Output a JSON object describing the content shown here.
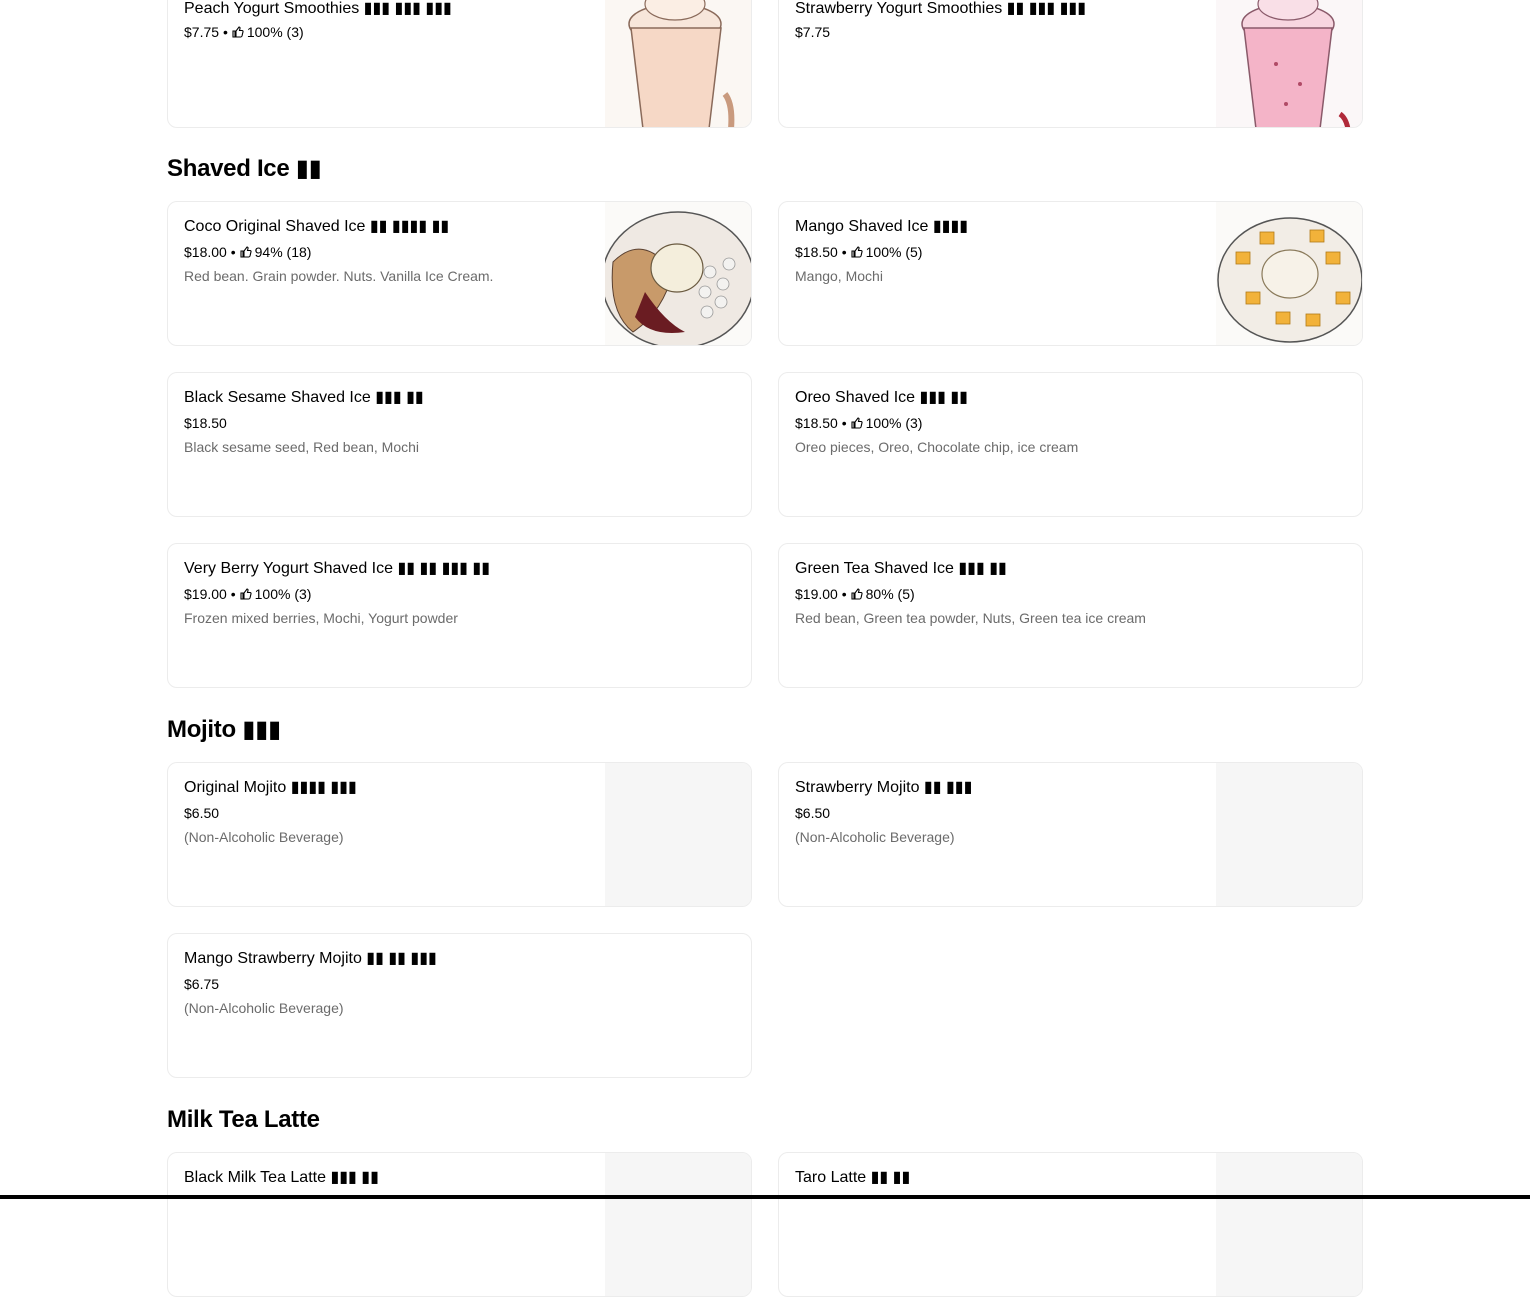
{
  "sections": [
    {
      "title": "",
      "items": [
        {
          "name": "Peach Yogurt Smoothies ▮▮▮ ▮▮▮ ▮▮▮",
          "price": "$7.75",
          "rating": "100% (3)",
          "desc": "",
          "thumb": "peach-smoothie"
        },
        {
          "name": "Strawberry Yogurt Smoothies ▮▮ ▮▮▮ ▮▮▮",
          "price": "$7.75",
          "rating": "",
          "desc": "",
          "thumb": "strawberry-smoothie"
        }
      ]
    },
    {
      "title": "Shaved Ice ▮▮",
      "items": [
        {
          "name": "Coco Original Shaved Ice ▮▮ ▮▮▮▮ ▮▮",
          "price": "$18.00",
          "rating": "94% (18)",
          "desc": "Red bean. Grain powder. Nuts. Vanilla Ice Cream.",
          "thumb": "coco-shaved-ice"
        },
        {
          "name": "Mango Shaved Ice ▮▮▮▮",
          "price": "$18.50",
          "rating": "100% (5)",
          "desc": "Mango, Mochi",
          "thumb": "mango-shaved-ice"
        },
        {
          "name": "Black Sesame Shaved Ice ▮▮▮ ▮▮",
          "price": "$18.50",
          "rating": "",
          "desc": "Black sesame seed, Red bean, Mochi",
          "thumb": ""
        },
        {
          "name": "Oreo Shaved Ice ▮▮▮ ▮▮",
          "price": "$18.50",
          "rating": "100% (3)",
          "desc": "Oreo pieces, Oreo, Chocolate chip, ice cream",
          "thumb": ""
        },
        {
          "name": "Very Berry Yogurt Shaved Ice ▮▮ ▮▮ ▮▮▮ ▮▮",
          "price": "$19.00",
          "rating": "100% (3)",
          "desc": "Frozen mixed berries, Mochi, Yogurt powder",
          "thumb": ""
        },
        {
          "name": "Green Tea Shaved Ice ▮▮▮ ▮▮",
          "price": "$19.00",
          "rating": "80% (5)",
          "desc": "Red bean, Green tea powder, Nuts, Green tea ice cream",
          "thumb": ""
        }
      ]
    },
    {
      "title": "Mojito ▮▮▮",
      "items": [
        {
          "name": "Original Mojito ▮▮▮▮ ▮▮▮",
          "price": "$6.50",
          "rating": "",
          "desc": "(Non-Alcoholic Beverage)",
          "thumb": "placeholder"
        },
        {
          "name": "Strawberry Mojito ▮▮ ▮▮▮",
          "price": "$6.50",
          "rating": "",
          "desc": "(Non-Alcoholic Beverage)",
          "thumb": "placeholder"
        },
        {
          "name": "Mango Strawberry Mojito ▮▮ ▮▮ ▮▮▮",
          "price": "$6.75",
          "rating": "",
          "desc": "(Non-Alcoholic Beverage)",
          "thumb": ""
        }
      ]
    },
    {
      "title": "Milk Tea Latte",
      "items": [
        {
          "name": "Black Milk Tea Latte ▮▮▮ ▮▮",
          "price": "",
          "rating": "",
          "desc": "",
          "thumb": "placeholder"
        },
        {
          "name": "Taro Latte ▮▮ ▮▮",
          "price": "",
          "rating": "",
          "desc": "",
          "thumb": "placeholder"
        }
      ]
    }
  ],
  "icons": {
    "rating": "thumbs-up-icon"
  },
  "colors": {
    "description": "#6b6b6b",
    "border": "#ececec",
    "placeholder": "#f6f6f6"
  }
}
